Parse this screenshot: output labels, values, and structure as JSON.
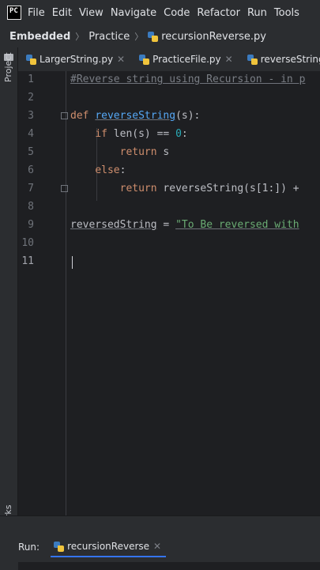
{
  "app_logo_text": "PC",
  "menu": [
    "File",
    "Edit",
    "View",
    "Navigate",
    "Code",
    "Refactor",
    "Run",
    "Tools"
  ],
  "breadcrumb": {
    "project": "Embedded",
    "folder": "Practice",
    "file": "recursionReverse.py"
  },
  "left_strip": {
    "project_label": "Project",
    "bookmarks_label": "Bookmarks"
  },
  "tabs": [
    {
      "label": "LargerString.py"
    },
    {
      "label": "PracticeFile.py"
    },
    {
      "label": "reverseString.py"
    }
  ],
  "editor": {
    "line_numbers": [
      "1",
      "2",
      "3",
      "4",
      "5",
      "6",
      "7",
      "8",
      "9",
      "10",
      "11"
    ],
    "current_line": "11",
    "comment_line": "#Reverse string using Recursion - in p",
    "def_kw": "def",
    "func_name": "reverseString",
    "def_params": "(s):",
    "if_kw": "if",
    "if_cond_a": " len(s) == ",
    "if_num": "0",
    "if_colon": ":",
    "return_kw": "return",
    "return_s": " s",
    "else_kw": "else",
    "else_colon": ":",
    "return2_rest": " reverseString(s[1:]) +",
    "var_name": "reversedString",
    "assign": " = ",
    "string_val": "\"To Be reversed with"
  },
  "run_panel": {
    "label": "Run:",
    "tab_name": "recursionReverse",
    "close": "✕"
  },
  "colors": {
    "keyword": "#cf8e6d",
    "function": "#56a8f5",
    "comment": "#7a7e85",
    "number": "#2aacb8",
    "string": "#6aab73"
  }
}
